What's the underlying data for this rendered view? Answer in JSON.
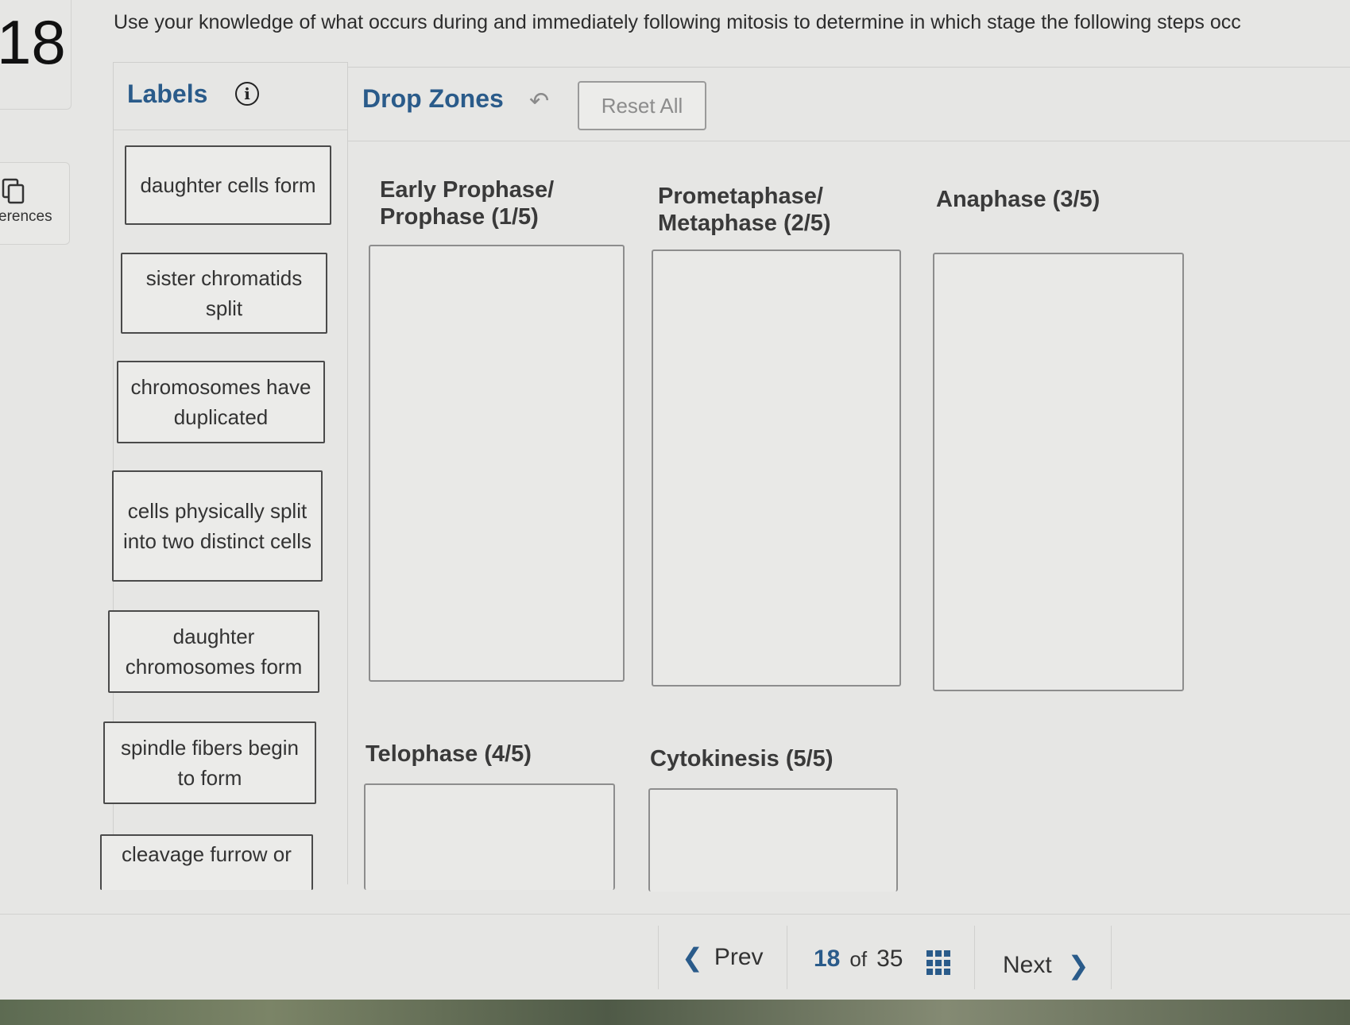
{
  "question": {
    "number": "18",
    "prompt": "Use your knowledge of what occurs during and immediately following mitosis to determine in which stage the following steps occ"
  },
  "sidebar": {
    "references_label": "erences",
    "references_icon": "copy-stack-icon"
  },
  "labels_panel": {
    "title": "Labels",
    "info_icon": "info-icon",
    "items": [
      "daughter cells form",
      "sister chromatids split",
      "chromosomes have duplicated",
      "cells physically split into two distinct cells",
      "daughter chromosomes form",
      "spindle fibers begin to form",
      "cleavage furrow or"
    ]
  },
  "drop_zones_panel": {
    "title": "Drop Zones",
    "undo_icon": "undo-arrow-icon",
    "reset_label": "Reset All",
    "zones": [
      {
        "line1": "Early Prophase/",
        "line2": "Prophase (1/5)"
      },
      {
        "line1": "Prometaphase/",
        "line2": "Metaphase (2/5)"
      },
      {
        "line1": "Anaphase (3/5)",
        "line2": ""
      },
      {
        "line1": "Telophase (4/5)",
        "line2": ""
      },
      {
        "line1": "Cytokinesis (5/5)",
        "line2": ""
      }
    ]
  },
  "pagination": {
    "prev_label": "Prev",
    "current": "18",
    "of_label": "of",
    "total": "35",
    "next_label": "Next",
    "grid_icon": "grid-menu-icon"
  },
  "colors": {
    "accent": "#2a5b8a",
    "background": "#e6e6e4",
    "border": "#4a4a4a"
  }
}
